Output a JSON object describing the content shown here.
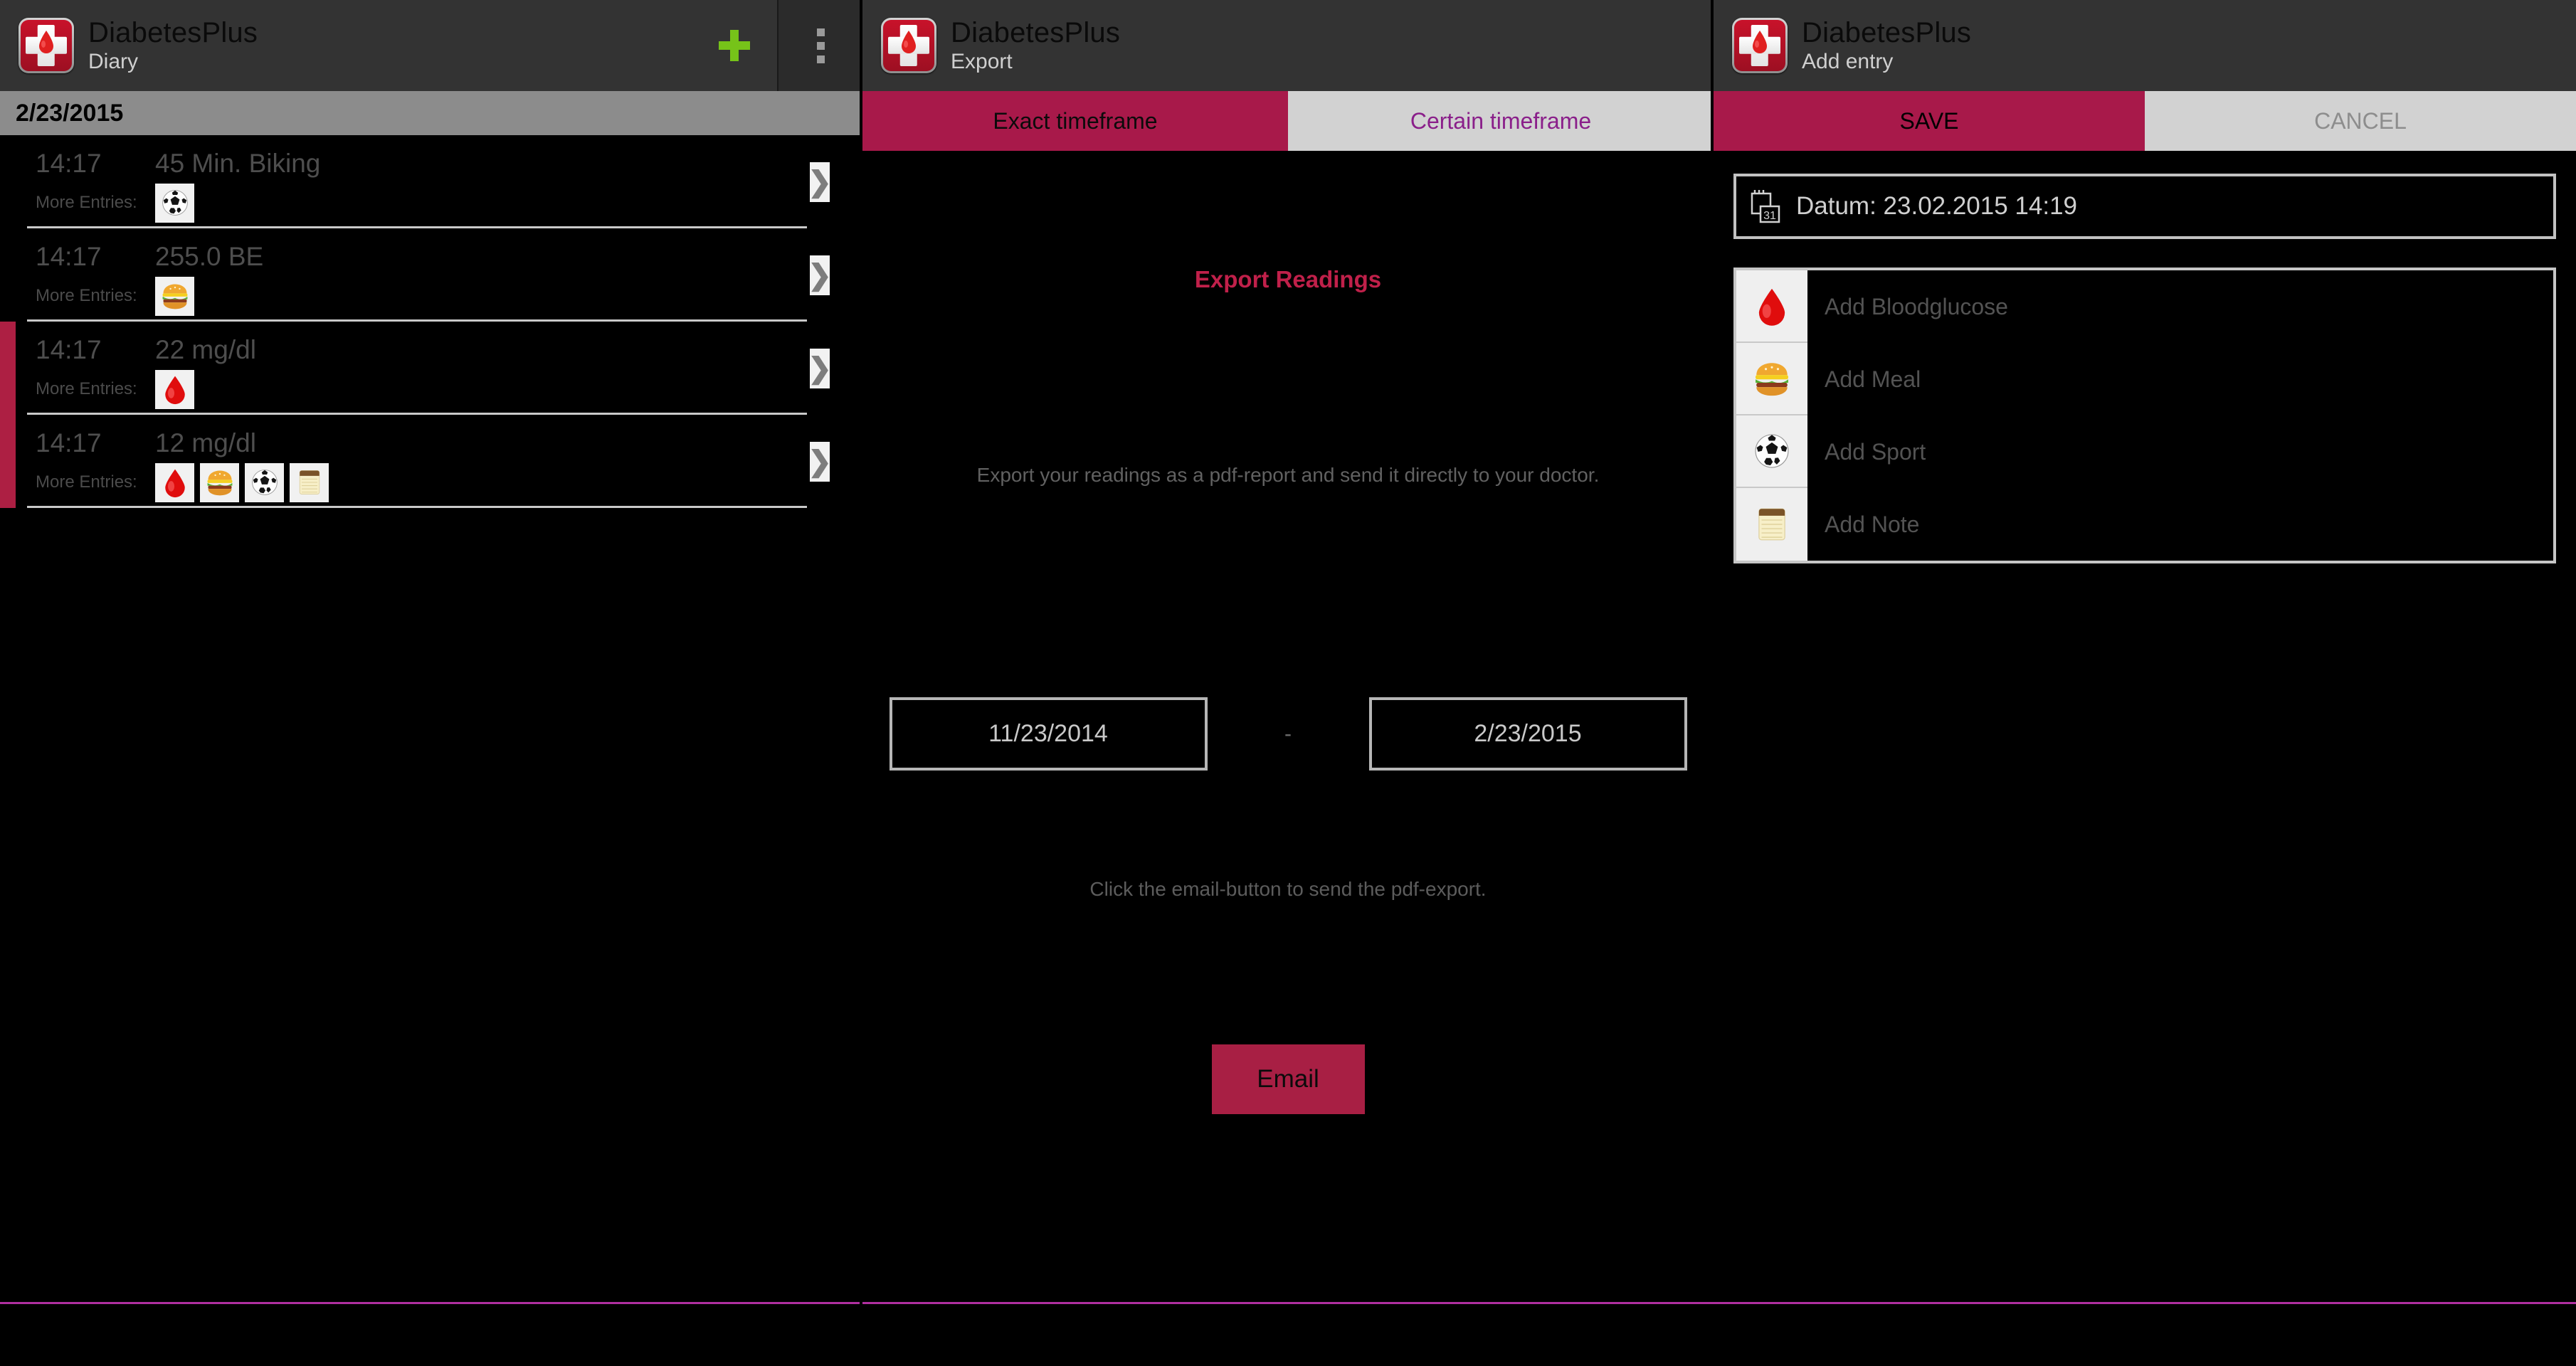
{
  "app": {
    "name": "DiabetesPlus"
  },
  "colors": {
    "accent_crimson": "#a8194a",
    "accent_red_bar": "#ad1f43",
    "action_bar": "#333333",
    "date_header_bg": "#8c8c8c",
    "plus_green": "#76c319",
    "tab_unselected_bg": "#d2d2d2",
    "tab_unselected_text": "#8a1f8a",
    "export_title": "#c0204a",
    "bottom_rule": "#b02fa0"
  },
  "diary": {
    "title": "DiabetesPlus",
    "subtitle": "Diary",
    "add_icon": "plus-icon",
    "overflow_icon": "overflow-menu-icon",
    "date_header": "2/23/2015",
    "more_entries_label": "More Entries:",
    "chevron": "❯",
    "rows": [
      {
        "time": "14:17",
        "value": "45 Min. Biking",
        "highlight": false,
        "icons": [
          "soccer-ball-icon"
        ]
      },
      {
        "time": "14:17",
        "value": "255.0 BE",
        "highlight": false,
        "icons": [
          "hamburger-icon"
        ]
      },
      {
        "time": "14:17",
        "value": "22 mg/dl",
        "highlight": true,
        "icons": [
          "blood-drop-icon"
        ]
      },
      {
        "time": "14:17",
        "value": "12 mg/dl",
        "highlight": true,
        "icons": [
          "blood-drop-icon",
          "hamburger-icon",
          "soccer-ball-icon",
          "notepad-icon"
        ]
      }
    ]
  },
  "export": {
    "title": "DiabetesPlus",
    "subtitle": "Export",
    "tabs": [
      {
        "label": "Exact timeframe",
        "selected": true
      },
      {
        "label": "Certain timeframe",
        "selected": false
      }
    ],
    "heading": "Export Readings",
    "description": "Export your readings as a pdf-report and send it directly to your doctor.",
    "date_from": "11/23/2014",
    "date_to": "2/23/2015",
    "date_separator": "-",
    "hint": "Click the email-button to send the pdf-export.",
    "email_button": "Email"
  },
  "add_entry": {
    "title": "DiabetesPlus",
    "subtitle": "Add entry",
    "save_label": "SAVE",
    "cancel_label": "CANCEL",
    "datum": "Datum: 23.02.2015 14:19",
    "calendar_icon_day": "31",
    "items": [
      {
        "label": "Add Bloodglucose",
        "icon": "blood-drop-icon"
      },
      {
        "label": "Add Meal",
        "icon": "hamburger-icon"
      },
      {
        "label": "Add Sport",
        "icon": "soccer-ball-icon"
      },
      {
        "label": "Add Note",
        "icon": "notepad-icon"
      }
    ]
  }
}
